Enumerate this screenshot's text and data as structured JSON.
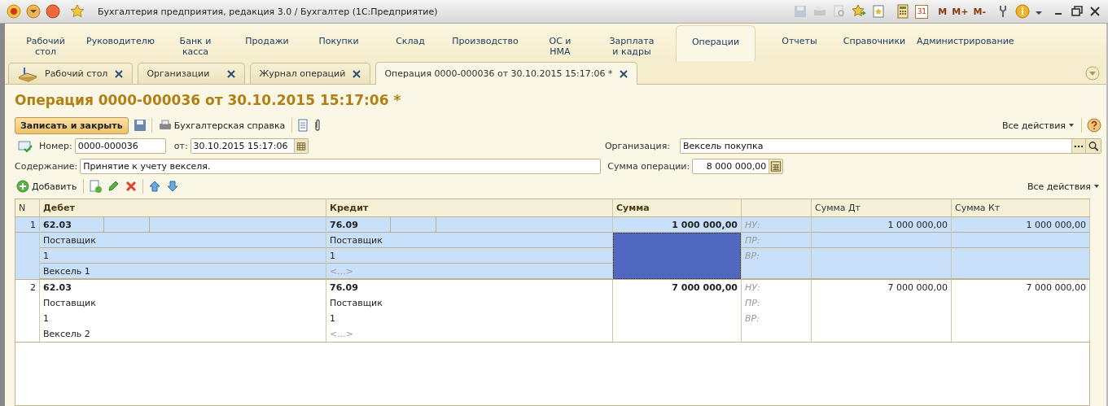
{
  "window": {
    "title": "Бухгалтерия предприятия, редакция 3.0 / Бухгалтер  (1С:Предприятие)",
    "memory_buttons": [
      "M",
      "M+",
      "M-"
    ],
    "calendar_day": "31"
  },
  "sections": [
    {
      "label": "Рабочий\nстол",
      "selected": false
    },
    {
      "label": "Руководителю",
      "selected": false
    },
    {
      "label": "Банк и\nкасса",
      "selected": false
    },
    {
      "label": "Продажи",
      "selected": false
    },
    {
      "label": "Покупки",
      "selected": false
    },
    {
      "label": "Склад",
      "selected": false
    },
    {
      "label": "Производство",
      "selected": false
    },
    {
      "label": "ОС и\nНМА",
      "selected": false
    },
    {
      "label": "Зарплата\nи кадры",
      "selected": false
    },
    {
      "label": "Операции",
      "selected": true
    },
    {
      "label": "Отчеты",
      "selected": false
    },
    {
      "label": "Справочники",
      "selected": false
    },
    {
      "label": "Администрирование",
      "selected": false
    }
  ],
  "tabs": [
    {
      "label": "Рабочий стол",
      "selected": false,
      "kind": "home"
    },
    {
      "label": "Организации",
      "selected": false,
      "kind": "plain"
    },
    {
      "label": "Журнал операций",
      "selected": false,
      "kind": "plain"
    },
    {
      "label": "Операция 0000-000036 от 30.10.2015 15:17:06 *",
      "selected": true,
      "kind": "plain"
    }
  ],
  "form": {
    "title": "Операция 0000-000036 от 30.10.2015 15:17:06 *",
    "save_close": "Записать и закрыть",
    "report": "Бухгалтерская справка",
    "all_actions": "Все действия",
    "number_label": "Номер:",
    "number": "0000-000036",
    "date_label": "от:",
    "date": "30.10.2015 15:17:06",
    "org_label": "Организация:",
    "org": "Вексель покупка",
    "choice_button": "...",
    "content_label": "Содержание:",
    "content": "Принятие к учету векселя.",
    "sum_label": "Сумма операции:",
    "sum": "8 000 000,00"
  },
  "table_toolbar": {
    "add": "Добавить",
    "all_actions": "Все действия"
  },
  "table": {
    "columns": [
      "N",
      "Дебет",
      "Кредит",
      "Сумма",
      "Сумма Дт",
      "Сумма Кт"
    ],
    "rows": [
      {
        "n": "1",
        "selected": true,
        "debit": {
          "account": "62.03",
          "subconto": [
            "Поставщик",
            "1",
            "Вексель 1"
          ]
        },
        "credit": {
          "account": "76.09",
          "subconto": [
            "Поставщик",
            "1",
            "<...>"
          ]
        },
        "sum": "1 000 000,00",
        "labels": [
          "НУ:",
          "ПР:",
          "ВР:"
        ],
        "sum_dt": "1 000 000,00",
        "sum_kt": "1 000 000,00"
      },
      {
        "n": "2",
        "selected": false,
        "debit": {
          "account": "62.03",
          "subconto": [
            "Поставщик",
            "1",
            "Вексель 2"
          ]
        },
        "credit": {
          "account": "76.09",
          "subconto": [
            "Поставщик",
            "1",
            "<...>"
          ]
        },
        "sum": "7 000 000,00",
        "labels": [
          "НУ:",
          "ПР:",
          "ВР:"
        ],
        "sum_dt": "7 000 000,00",
        "sum_kt": "7 000 000,00"
      }
    ]
  }
}
